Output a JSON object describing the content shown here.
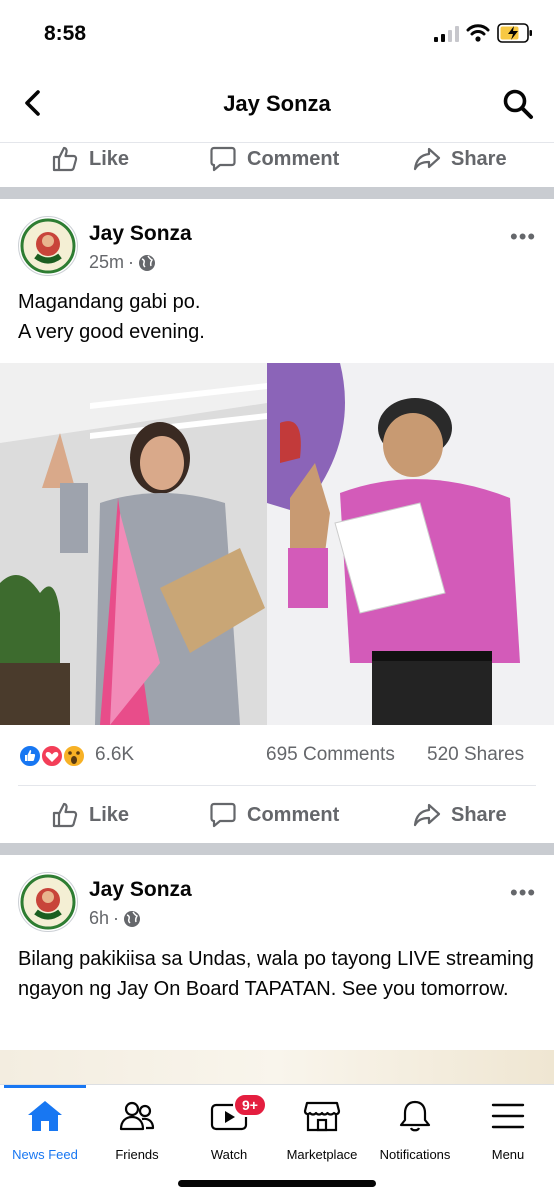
{
  "status_bar": {
    "time": "8:58"
  },
  "nav": {
    "title": "Jay Sonza"
  },
  "actions": {
    "like": "Like",
    "comment": "Comment",
    "share": "Share"
  },
  "posts": [
    {
      "author": "Jay Sonza",
      "time": "25m",
      "separator": "·",
      "text_line1": "Magandang gabi po.",
      "text_line2": "A very good evening.",
      "reactions_count": "6.6K",
      "comments": "695 Comments",
      "shares": "520 Shares"
    },
    {
      "author": "Jay Sonza",
      "time": "6h",
      "separator": "·",
      "text": "Bilang pakikiisa sa Undas, wala po tayong LIVE streaming ngayon ng Jay On Board TAPATAN. See you tomorrow."
    }
  ],
  "avatar_text": {
    "top": "Jay On Board",
    "bottom": "TAPATAN"
  },
  "tabbar": {
    "news_feed": "News Feed",
    "friends": "Friends",
    "watch": "Watch",
    "watch_badge": "9+",
    "marketplace": "Marketplace",
    "notifications": "Notifications",
    "menu": "Menu"
  },
  "colors": {
    "accent": "#1877f2",
    "secondary_text": "#65676b",
    "badge": "#e41e3f"
  }
}
